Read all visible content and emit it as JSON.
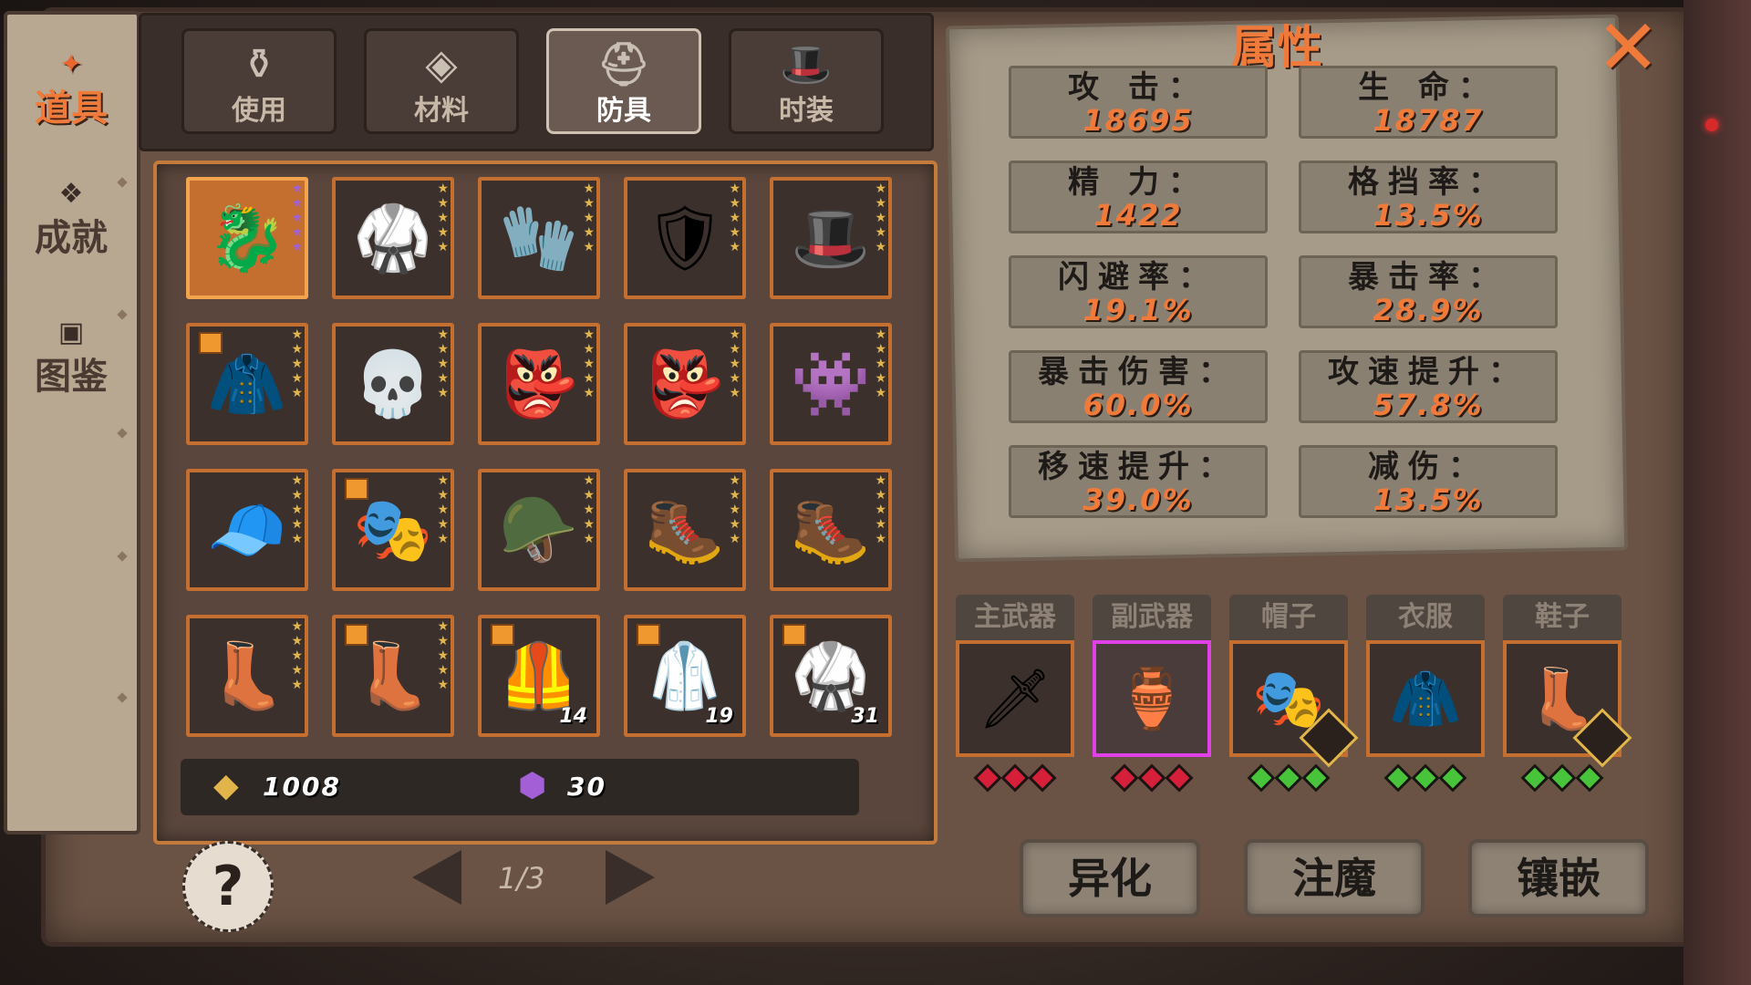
{
  "sidebar": {
    "items": [
      {
        "label": "道具",
        "icon": "item-bag-icon",
        "active": true
      },
      {
        "label": "成就",
        "icon": "achievement-emblem-icon",
        "active": false
      },
      {
        "label": "图鉴",
        "icon": "codex-book-icon",
        "active": false
      }
    ]
  },
  "categories": [
    {
      "label": "使用",
      "icon": "potion-bottle-icon",
      "active": false
    },
    {
      "label": "材料",
      "icon": "ore-material-icon",
      "active": false
    },
    {
      "label": "防具",
      "icon": "helmet-icon",
      "active": true
    },
    {
      "label": "时装",
      "icon": "top-hat-icon",
      "active": false
    }
  ],
  "inventory": {
    "items": [
      {
        "name": "dragon-armor",
        "glyph": "🐉",
        "stars": "purple",
        "selected": true
      },
      {
        "name": "bandage-armor",
        "glyph": "🥋",
        "stars": "gold"
      },
      {
        "name": "spiked-gauntlet",
        "glyph": "🧤",
        "stars": "gold"
      },
      {
        "name": "shoulder-armor",
        "glyph": "🛡",
        "stars": "gold"
      },
      {
        "name": "fur-hat",
        "glyph": "🎩",
        "stars": "gold"
      },
      {
        "name": "hooded-jacket",
        "glyph": "🧥",
        "stars": "gold",
        "tag": true
      },
      {
        "name": "skull-helmet",
        "glyph": "💀",
        "stars": "gold"
      },
      {
        "name": "teal-mask",
        "glyph": "👺",
        "stars": "gold"
      },
      {
        "name": "teal-mask-2",
        "glyph": "👺",
        "stars": "gold"
      },
      {
        "name": "purple-beast-helm",
        "glyph": "👾",
        "stars": "gold"
      },
      {
        "name": "bandana",
        "glyph": "🧢",
        "stars": "gold"
      },
      {
        "name": "white-mask",
        "glyph": "🎭",
        "stars": "gold",
        "tag": true
      },
      {
        "name": "dark-hood",
        "glyph": "🪖",
        "stars": "gold"
      },
      {
        "name": "iron-boots",
        "glyph": "🥾",
        "stars": "gold"
      },
      {
        "name": "iron-boots-2",
        "glyph": "🥾",
        "stars": "gold"
      },
      {
        "name": "red-boots",
        "glyph": "👢",
        "stars": "gold"
      },
      {
        "name": "wrapped-boots",
        "glyph": "👢",
        "stars": "gold",
        "tag": true
      },
      {
        "name": "red-vest",
        "glyph": "🦺",
        "count": "14",
        "tag": true
      },
      {
        "name": "white-robe",
        "glyph": "🥼",
        "count": "19",
        "tag": true
      },
      {
        "name": "bandage-fragment",
        "glyph": "🥋",
        "count": "31",
        "tag": true
      }
    ]
  },
  "currency": {
    "gold_value": "1008",
    "gold_icon": "gold-crystal-icon",
    "gem_value": "30",
    "gem_icon": "purple-gem-icon"
  },
  "pager": {
    "text": "1/3"
  },
  "attributes": {
    "title": "属性",
    "stats": [
      {
        "label": "攻 击：",
        "value": "18695"
      },
      {
        "label": "生 命：",
        "value": "18787"
      },
      {
        "label": "精 力：",
        "value": "1422"
      },
      {
        "label": "格挡率：",
        "value": "13.5%"
      },
      {
        "label": "闪避率：",
        "value": "19.1%"
      },
      {
        "label": "暴击率：",
        "value": "28.9%"
      },
      {
        "label": "暴击伤害：",
        "value": "60.0%"
      },
      {
        "label": "攻速提升：",
        "value": "57.8%"
      },
      {
        "label": "移速提升：",
        "value": "39.0%"
      },
      {
        "label": "减伤：",
        "value": "13.5%"
      }
    ]
  },
  "equipment": [
    {
      "label": "主武器",
      "glyph": "🗡",
      "gems": "red"
    },
    {
      "label": "副武器",
      "glyph": "🏺",
      "gems": "red"
    },
    {
      "label": "帽子",
      "glyph": "🎭",
      "gems": "green"
    },
    {
      "label": "衣服",
      "glyph": "🧥",
      "gems": "green"
    },
    {
      "label": "鞋子",
      "glyph": "👢",
      "gems": "green"
    }
  ],
  "actions": [
    {
      "label": "异化"
    },
    {
      "label": "注魔"
    },
    {
      "label": "镶嵌"
    }
  ],
  "colors": {
    "accent": "#f07a3a",
    "slot_border": "#c46e30",
    "pink_border": "#e040e8"
  }
}
